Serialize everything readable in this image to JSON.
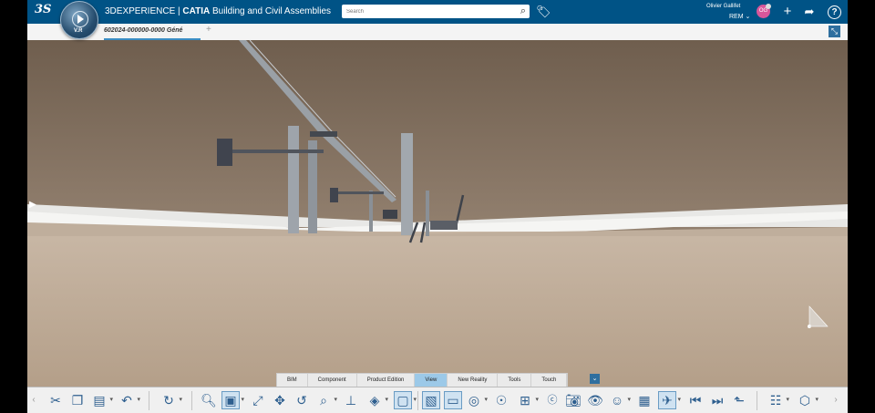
{
  "topbar": {
    "logo": "3S",
    "compass_version": "V.R",
    "brand": "3DEXPERIENCE",
    "separator": " | ",
    "app_bold": "CATIA",
    "app_rest": " Building and Civil Assemblies",
    "search_placeholder": "Search",
    "user_name": "Olivier Gallifet",
    "user_role": "REM",
    "avatar_initials": "OG"
  },
  "tabbar": {
    "document_tab": "602024-000000-0000 Géné",
    "add_tab": "+"
  },
  "section_tabs": [
    {
      "label": "BIM",
      "active": false
    },
    {
      "label": "Component",
      "active": false
    },
    {
      "label": "Product Edition",
      "active": false
    },
    {
      "label": "View",
      "active": true
    },
    {
      "label": "New Reality",
      "active": false
    },
    {
      "label": "Tools",
      "active": false
    },
    {
      "label": "Touch",
      "active": false
    }
  ],
  "toolbar_icons": [
    "scroll-left-icon",
    "cut-icon",
    "copy-icon",
    "paste-icon",
    "undo-icon",
    "update-icon",
    "zoom-icon",
    "view-cube-icon",
    "fit-all-icon",
    "pan-icon",
    "rotate-icon",
    "zoom-area-icon",
    "normal-view-icon",
    "render-style-icon",
    "capture-icon",
    "display-icon",
    "visibility-icon",
    "lighting-icon",
    "layout-icon",
    "previous-icon",
    "camera-icon",
    "look-icon",
    "walk-icon",
    "fly-icon",
    "measure-icon",
    "first-icon",
    "next-icon",
    "snapshot-icon",
    "tree-icon",
    "cube-icon",
    "scroll-right-icon"
  ]
}
